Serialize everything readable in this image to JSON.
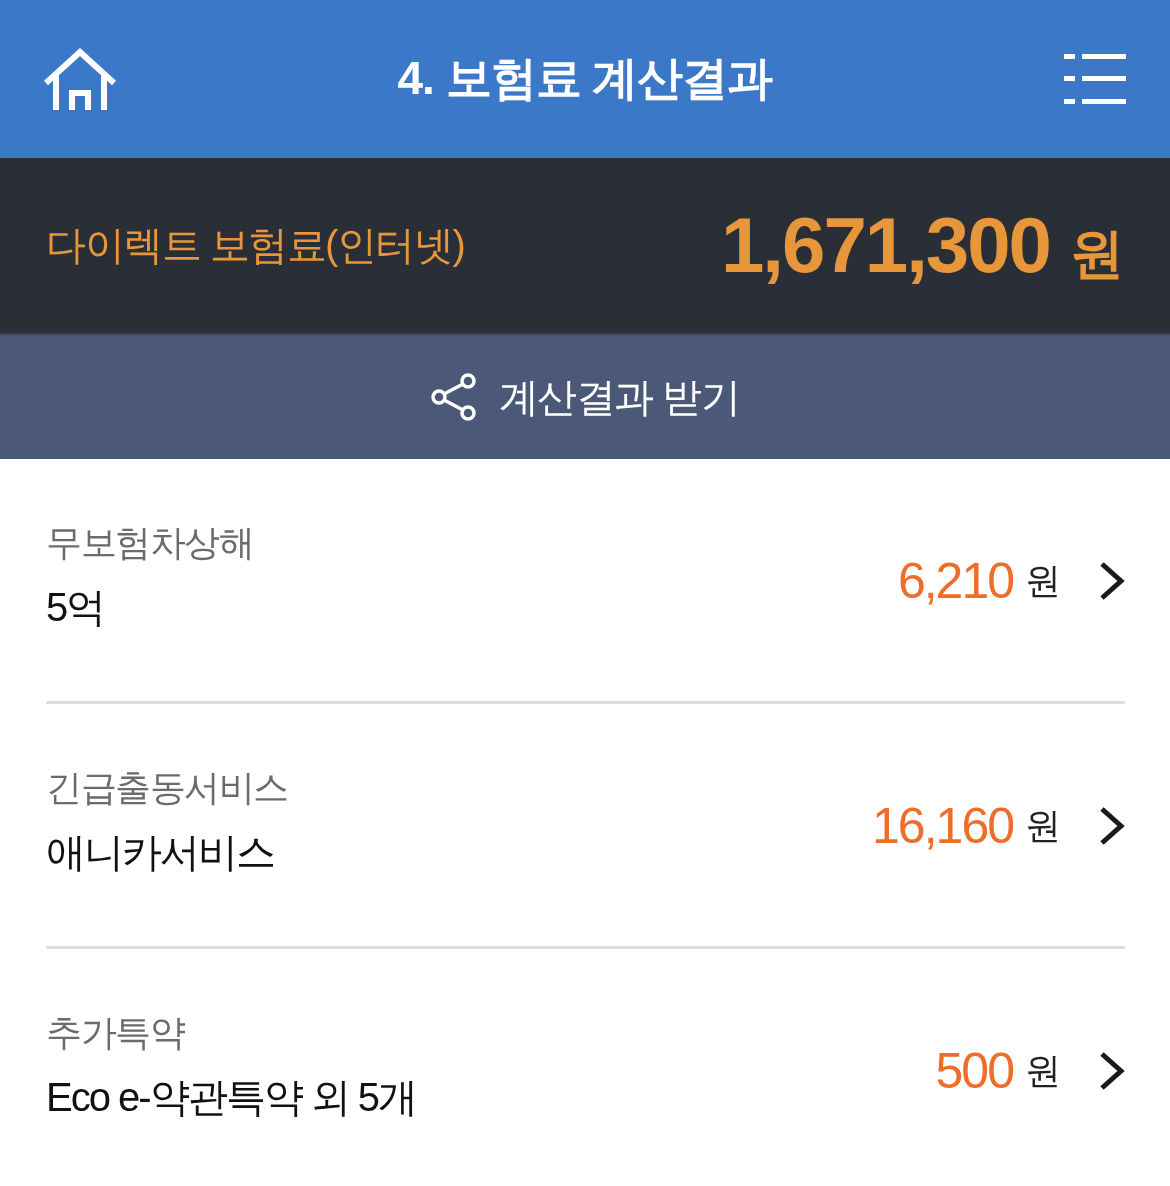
{
  "header": {
    "title": "4. 보험료 계산결과"
  },
  "total": {
    "label": "다이렉트 보험료(인터넷)",
    "amount": "1,671,300",
    "unit": "원"
  },
  "share_button": {
    "label": "계산결과 받기"
  },
  "items": [
    {
      "label": "무보험차상해",
      "value": "5억",
      "price": "6,210",
      "unit": "원"
    },
    {
      "label": "긴급출동서비스",
      "value": "애니카서비스",
      "price": "16,160",
      "unit": "원"
    },
    {
      "label": "추가특약",
      "value": "Eco e-약관특약 외 5개",
      "price": "500",
      "unit": "원"
    }
  ]
}
